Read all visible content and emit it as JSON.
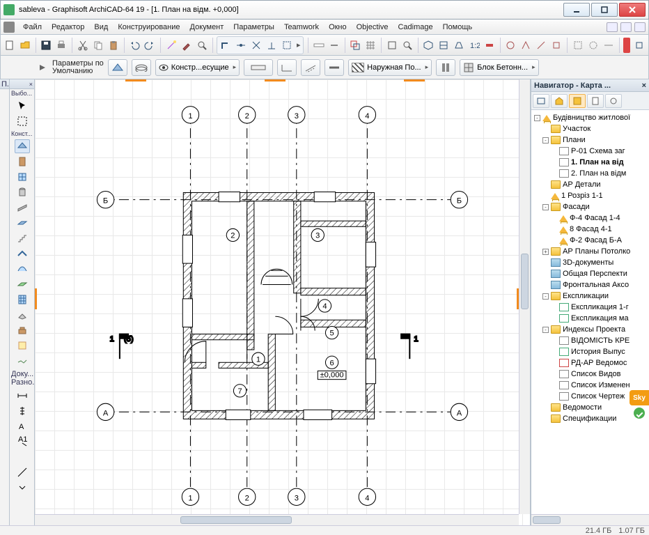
{
  "window": {
    "title": "sableva - Graphisoft ArchiCAD-64 19 - [1. План на відм. +0,000]"
  },
  "menu": {
    "items": [
      "Файл",
      "Редактор",
      "Вид",
      "Конструирование",
      "Документ",
      "Параметры",
      "Teamwork",
      "Окно",
      "Objective",
      "Cadimage",
      "Помощь"
    ]
  },
  "infobar": {
    "label_line1": "Параметры по",
    "label_line2": "Умолчанию",
    "layer_label": "Констр...есущие",
    "surface_label": "Наружная По...",
    "material_label": "Блок Бетонн..."
  },
  "left_palettes": {
    "p1_title": "П...",
    "p2_title": "Выбо...",
    "p3_title": "Конст...",
    "p4_line1": "Доку...",
    "p4_line2": "Разно..."
  },
  "navigator": {
    "title": "Навигатор - Карта ...",
    "tree": [
      {
        "ind": 0,
        "exp": "-",
        "icon": "house",
        "label": "Будівництво житлової"
      },
      {
        "ind": 1,
        "exp": "",
        "icon": "folder",
        "label": "Участок"
      },
      {
        "ind": 1,
        "exp": "-",
        "icon": "folder",
        "label": "Плани"
      },
      {
        "ind": 2,
        "exp": "",
        "icon": "sheet",
        "label": "Р-01 Схема заг"
      },
      {
        "ind": 2,
        "exp": "",
        "icon": "sheet",
        "label": "1. План на від",
        "sel": true
      },
      {
        "ind": 2,
        "exp": "",
        "icon": "sheet",
        "label": "2. План на відм"
      },
      {
        "ind": 1,
        "exp": "",
        "icon": "folder",
        "label": "АР Детали"
      },
      {
        "ind": 1,
        "exp": "",
        "icon": "house",
        "label": "1 Розріз 1-1"
      },
      {
        "ind": 1,
        "exp": "-",
        "icon": "folder",
        "label": "Фасади"
      },
      {
        "ind": 2,
        "exp": "",
        "icon": "house",
        "label": "Ф-4 Фасад 1-4"
      },
      {
        "ind": 2,
        "exp": "",
        "icon": "house",
        "label": "8 Фасад 4-1"
      },
      {
        "ind": 2,
        "exp": "",
        "icon": "house",
        "label": "Ф-2 Фасад Б-А"
      },
      {
        "ind": 1,
        "exp": "+",
        "icon": "folder",
        "label": "АР Планы Потолко"
      },
      {
        "ind": 1,
        "exp": "",
        "icon": "model",
        "label": "3D-документы"
      },
      {
        "ind": 1,
        "exp": "",
        "icon": "model",
        "label": "Общая Перспекти"
      },
      {
        "ind": 1,
        "exp": "",
        "icon": "model",
        "label": "Фронтальная Аксо"
      },
      {
        "ind": 1,
        "exp": "-",
        "icon": "folder",
        "label": "Експликации"
      },
      {
        "ind": 2,
        "exp": "",
        "icon": "sheet b",
        "label": "Експликация 1-г"
      },
      {
        "ind": 2,
        "exp": "",
        "icon": "sheet b",
        "label": "Експликация ма"
      },
      {
        "ind": 1,
        "exp": "-",
        "icon": "folder",
        "label": "Индексы Проекта"
      },
      {
        "ind": 2,
        "exp": "",
        "icon": "sheet",
        "label": "ВІДОМІСТЬ КРЕ"
      },
      {
        "ind": 2,
        "exp": "",
        "icon": "sheet b",
        "label": "История Выпус"
      },
      {
        "ind": 2,
        "exp": "",
        "icon": "sheet r",
        "label": "РД-АР Ведомос"
      },
      {
        "ind": 2,
        "exp": "",
        "icon": "sheet",
        "label": "Список Видов"
      },
      {
        "ind": 2,
        "exp": "",
        "icon": "sheet",
        "label": "Список Изменен"
      },
      {
        "ind": 2,
        "exp": "",
        "icon": "sheet",
        "label": "Список Чертеж"
      },
      {
        "ind": 1,
        "exp": "",
        "icon": "folder",
        "label": "Ведомости"
      },
      {
        "ind": 1,
        "exp": "",
        "icon": "folder",
        "label": "Спецификации"
      }
    ]
  },
  "plan": {
    "grid_cols": [
      "1",
      "2",
      "3",
      "4"
    ],
    "grid_rows": [
      "Б",
      "А"
    ],
    "rooms": [
      "1",
      "2",
      "3",
      "4",
      "5",
      "6",
      "7"
    ],
    "section_left": "1",
    "section_left_sub": "(5)",
    "section_right": "1",
    "level_mark": "±0,000"
  },
  "status": {
    "mem1": "21.4 ГБ",
    "mem2": "1.07 ГБ"
  },
  "skype": {
    "label": "Sky"
  }
}
